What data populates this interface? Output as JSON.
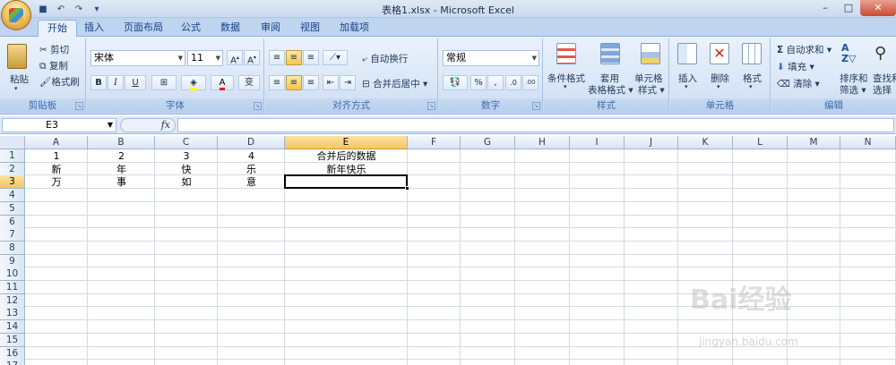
{
  "window": {
    "title": "表格1.xlsx - Microsoft Excel"
  },
  "qat": {
    "save_icon": "save-icon",
    "undo_icon": "undo-icon",
    "redo_icon": "redo-icon",
    "customize": "▾"
  },
  "tabs": [
    "开始",
    "插入",
    "页面布局",
    "公式",
    "数据",
    "审阅",
    "视图",
    "加载项"
  ],
  "ribbon": {
    "clipboard": {
      "label": "剪贴板",
      "paste": "粘贴",
      "cut": "剪切",
      "copy": "复制",
      "format_painter": "格式刷"
    },
    "font": {
      "label": "字体",
      "font_name": "宋体",
      "font_size": "11",
      "bold": "B",
      "italic": "I",
      "underline": "U",
      "font_color": "A",
      "phonetic": "变"
    },
    "alignment": {
      "label": "对齐方式",
      "wrap_text": "自动换行",
      "merge_center": "合并后居中"
    },
    "number": {
      "label": "数字",
      "format": "常规",
      "percent": "%",
      "comma": ",",
      "inc_decimal": ".0",
      "dec_decimal": ".00"
    },
    "styles": {
      "label": "样式",
      "conditional": "条件格式",
      "table_format_1": "套用",
      "table_format_2": "表格格式",
      "cell_styles_1": "单元格",
      "cell_styles_2": "样式"
    },
    "cells": {
      "label": "单元格",
      "insert": "插入",
      "delete": "删除",
      "format": "格式"
    },
    "editing": {
      "label": "编辑",
      "autosum": "自动求和",
      "fill": "填充",
      "clear": "清除",
      "sort_filter_1": "排序和",
      "sort_filter_2": "筛选",
      "find_select_1": "查找和",
      "find_select_2": "选择"
    }
  },
  "formula_bar": {
    "name_box": "E3",
    "fx": "fx",
    "content": ""
  },
  "grid": {
    "columns": [
      "A",
      "B",
      "C",
      "D",
      "E",
      "F",
      "G",
      "H",
      "I",
      "J",
      "K",
      "L",
      "M",
      "N"
    ],
    "rows": [
      "1",
      "2",
      "3",
      "4",
      "5",
      "6",
      "7",
      "8",
      "9",
      "10",
      "11",
      "12",
      "13",
      "14",
      "15",
      "16",
      "17"
    ],
    "selected_column": "E",
    "selected_row": "3",
    "cells": {
      "A1": "1",
      "B1": "2",
      "C1": "3",
      "D1": "4",
      "E1": "合并后的数据",
      "A2": "新",
      "B2": "年",
      "C2": "快",
      "D2": "乐",
      "E2": "新年快乐",
      "A3": "万",
      "B3": "事",
      "C3": "如",
      "D3": "意"
    }
  },
  "watermark": {
    "main": "Bai经验",
    "sub": "jingyan.baidu.com"
  }
}
